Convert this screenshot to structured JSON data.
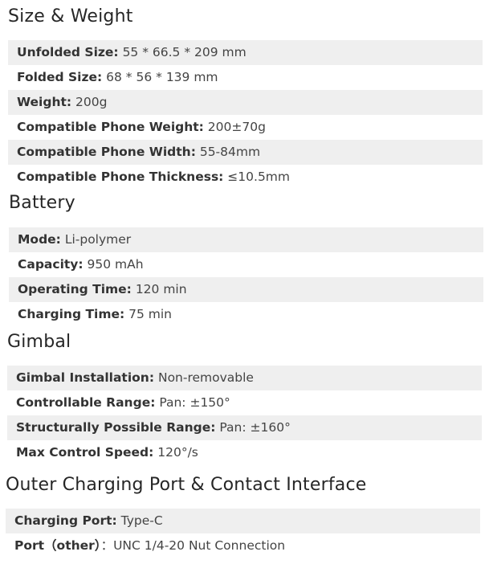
{
  "sections": [
    {
      "title": "Size & Weight",
      "rows": [
        {
          "label": "Unfolded Size:",
          "value": " 55 * 66.5 * 209 mm"
        },
        {
          "label": "Folded Size:",
          "value": " 68 * 56 * 139 mm"
        },
        {
          "label": "Weight:",
          "value": " 200g"
        },
        {
          "label": "Compatible Phone Weight:",
          "value": " 200±70g"
        },
        {
          "label": "Compatible Phone Width:",
          "value": " 55-84mm"
        },
        {
          "label": "Compatible Phone Thickness:",
          "value": " ≤10.5mm"
        }
      ]
    },
    {
      "title": "Battery",
      "rows": [
        {
          "label": "Mode:",
          "value": " Li-polymer"
        },
        {
          "label": "Capacity:",
          "value": " 950 mAh"
        },
        {
          "label": "Operating Time:",
          "value": " 120 min"
        },
        {
          "label": "Charging Time:",
          "value": " 75 min"
        }
      ]
    },
    {
      "title": "Gimbal",
      "rows": [
        {
          "label": "Gimbal Installation:",
          "value": " Non-removable"
        },
        {
          "label": "Controllable Range:",
          "value": " Pan: ±150°"
        },
        {
          "label": "Structurally Possible Range:",
          "value": "  Pan: ±160°"
        },
        {
          "label": "Max Control Speed:",
          "value": " 120°/s"
        }
      ]
    },
    {
      "title": "Outer Charging Port & Contact Interface",
      "rows": [
        {
          "label": "Charging Port:",
          "value": " Type-C"
        },
        {
          "label": "Port（other）",
          "value": "：UNC 1/4-20 Nut Connection"
        }
      ]
    }
  ]
}
